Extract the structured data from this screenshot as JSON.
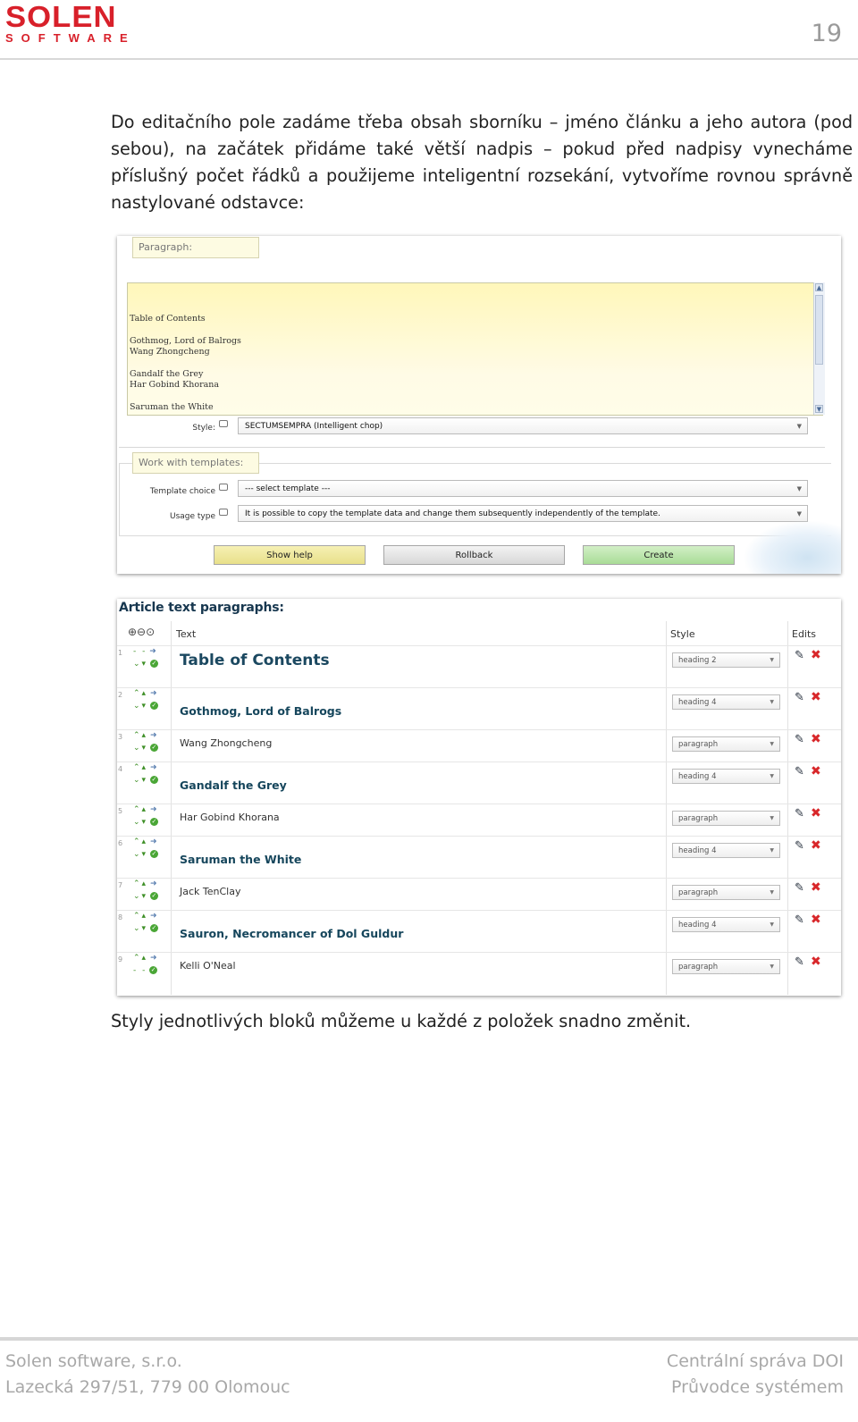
{
  "header": {
    "logo_main": "SOLEN",
    "logo_sub": "SOFTWARE",
    "page_number": "19"
  },
  "intro_text": "Do editačního pole zadáme třeba obsah sborníku – jméno článku a jeho autora (pod sebou), na začátek přidáme také větší nadpis – pokud před nadpisy vynecháme příslušný počet řádků a použijeme inteligentní rozsekání, vytvoříme rovnou správně nastylované odstavce:",
  "form": {
    "paragraph_label": "Paragraph:",
    "editor_lines": [
      "Table of Contents",
      "",
      "Gothmog, Lord of Balrogs",
      "Wang Zhongcheng",
      "",
      "Gandalf the Grey",
      "Har Gobind Khorana",
      "",
      "Saruman the White"
    ],
    "style_label": "Style:",
    "style_value": "SECTUMSEMPRA (Intelligent chop)",
    "templates_label": "Work with templates:",
    "template_choice_label": "Template choice",
    "template_choice_value": "--- select template ---",
    "usage_type_label": "Usage type",
    "usage_type_value": "It is possible to copy the template data and change them subsequently independently of the template.",
    "buttons": {
      "show_help": "Show help",
      "rollback": "Rollback",
      "create": "Create"
    }
  },
  "table": {
    "title": "Article text paragraphs:",
    "columns": {
      "text": "Text",
      "style": "Style",
      "edits": "Edits"
    },
    "rows": [
      {
        "num": "1",
        "text": "Table of Contents",
        "style": "heading 2",
        "kind": "h2"
      },
      {
        "num": "2",
        "text": "Gothmog, Lord of Balrogs",
        "style": "heading 4",
        "kind": "h4"
      },
      {
        "num": "3",
        "text": "Wang Zhongcheng",
        "style": "paragraph",
        "kind": "p"
      },
      {
        "num": "4",
        "text": "Gandalf the Grey",
        "style": "heading 4",
        "kind": "h4"
      },
      {
        "num": "5",
        "text": "Har Gobind Khorana",
        "style": "paragraph",
        "kind": "p"
      },
      {
        "num": "6",
        "text": "Saruman the White",
        "style": "heading 4",
        "kind": "h4"
      },
      {
        "num": "7",
        "text": "Jack TenClay",
        "style": "paragraph",
        "kind": "p"
      },
      {
        "num": "8",
        "text": "Sauron, Necromancer of Dol Guldur",
        "style": "heading 4",
        "kind": "h4"
      },
      {
        "num": "9",
        "text": "Kelli O'Neal",
        "style": "paragraph",
        "kind": "p"
      }
    ]
  },
  "outro_text": "Styly jednotlivých bloků můžeme u každé z položek snadno změnit.",
  "footer": {
    "company": "Solen software, s.r.o.",
    "address": "Lazecká 297/51, 779 00 Olomouc",
    "product": "Centrální správa DOI",
    "doc_type": "Průvodce systémem"
  }
}
